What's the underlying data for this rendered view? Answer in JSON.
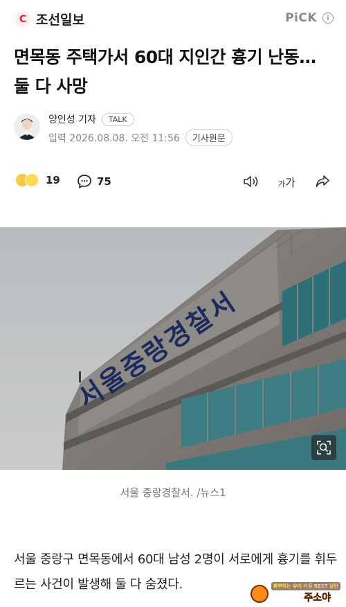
{
  "header": {
    "brand_logo": "C",
    "brand_name": "조선일보",
    "pick_label": "PiCK",
    "info_icon": "i"
  },
  "article": {
    "title": "면목동 주택가서 60대 지인간 흉기 난동… 둘 다 사망",
    "reporter": "양인성 기자",
    "talk_label": "TALK",
    "date": "입력 2026.08.08. 오전 11:56",
    "original_label": "기사원문"
  },
  "actions": {
    "reaction_count": "19",
    "comment_count": "75",
    "font_small": "가",
    "font_large": "가",
    "icons": [
      "reaction-emoji-icon",
      "comment-icon",
      "audio-icon",
      "font-size-icon",
      "share-icon"
    ]
  },
  "photo": {
    "sign_text": "서울중랑경찰서",
    "caption": "서울 중랑경찰서. /뉴스1"
  },
  "body": {
    "paragraph": "서울 중랑구 면목동에서 60대 남성 2명이 서로에게 흉기를 휘두르는 사건이 발생해 둘 다 숨졌다."
  },
  "watermark": {
    "tag": "뽐뿌하는 유머 커뮤 BEST 달린",
    "name": "주소야"
  },
  "colors": {
    "accent_red": "#d52a2a",
    "text_main": "#111111",
    "text_muted": "#888888"
  }
}
